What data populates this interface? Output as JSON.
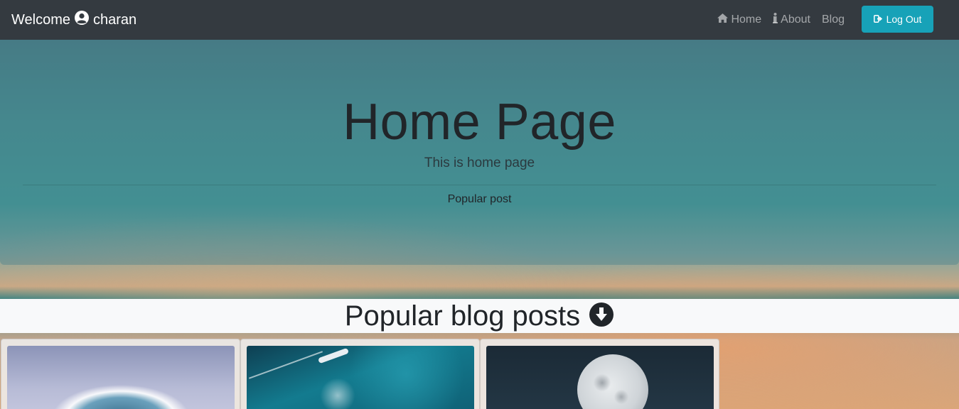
{
  "navbar": {
    "welcome": "Welcome",
    "username": "charan",
    "user_icon": "user-circle-icon",
    "links": [
      {
        "label": "Home",
        "icon": "home-icon"
      },
      {
        "label": "About",
        "icon": "info-icon"
      },
      {
        "label": "Blog",
        "icon": ""
      }
    ],
    "logout_label": "Log Out",
    "logout_icon": "sign-out-icon"
  },
  "jumbotron": {
    "title": "Home Page",
    "subtitle": "This is home page",
    "link": "Popular post"
  },
  "section": {
    "heading": "Popular blog posts",
    "icon": "arrow-circle-down-icon"
  },
  "cards": [
    {
      "image": "wave-image"
    },
    {
      "image": "boat-sea-image"
    },
    {
      "image": "moon-image"
    }
  ],
  "colors": {
    "navbar_bg": "#343a40",
    "accent": "#17a2b8",
    "heading_bg": "#f8f9fa"
  }
}
